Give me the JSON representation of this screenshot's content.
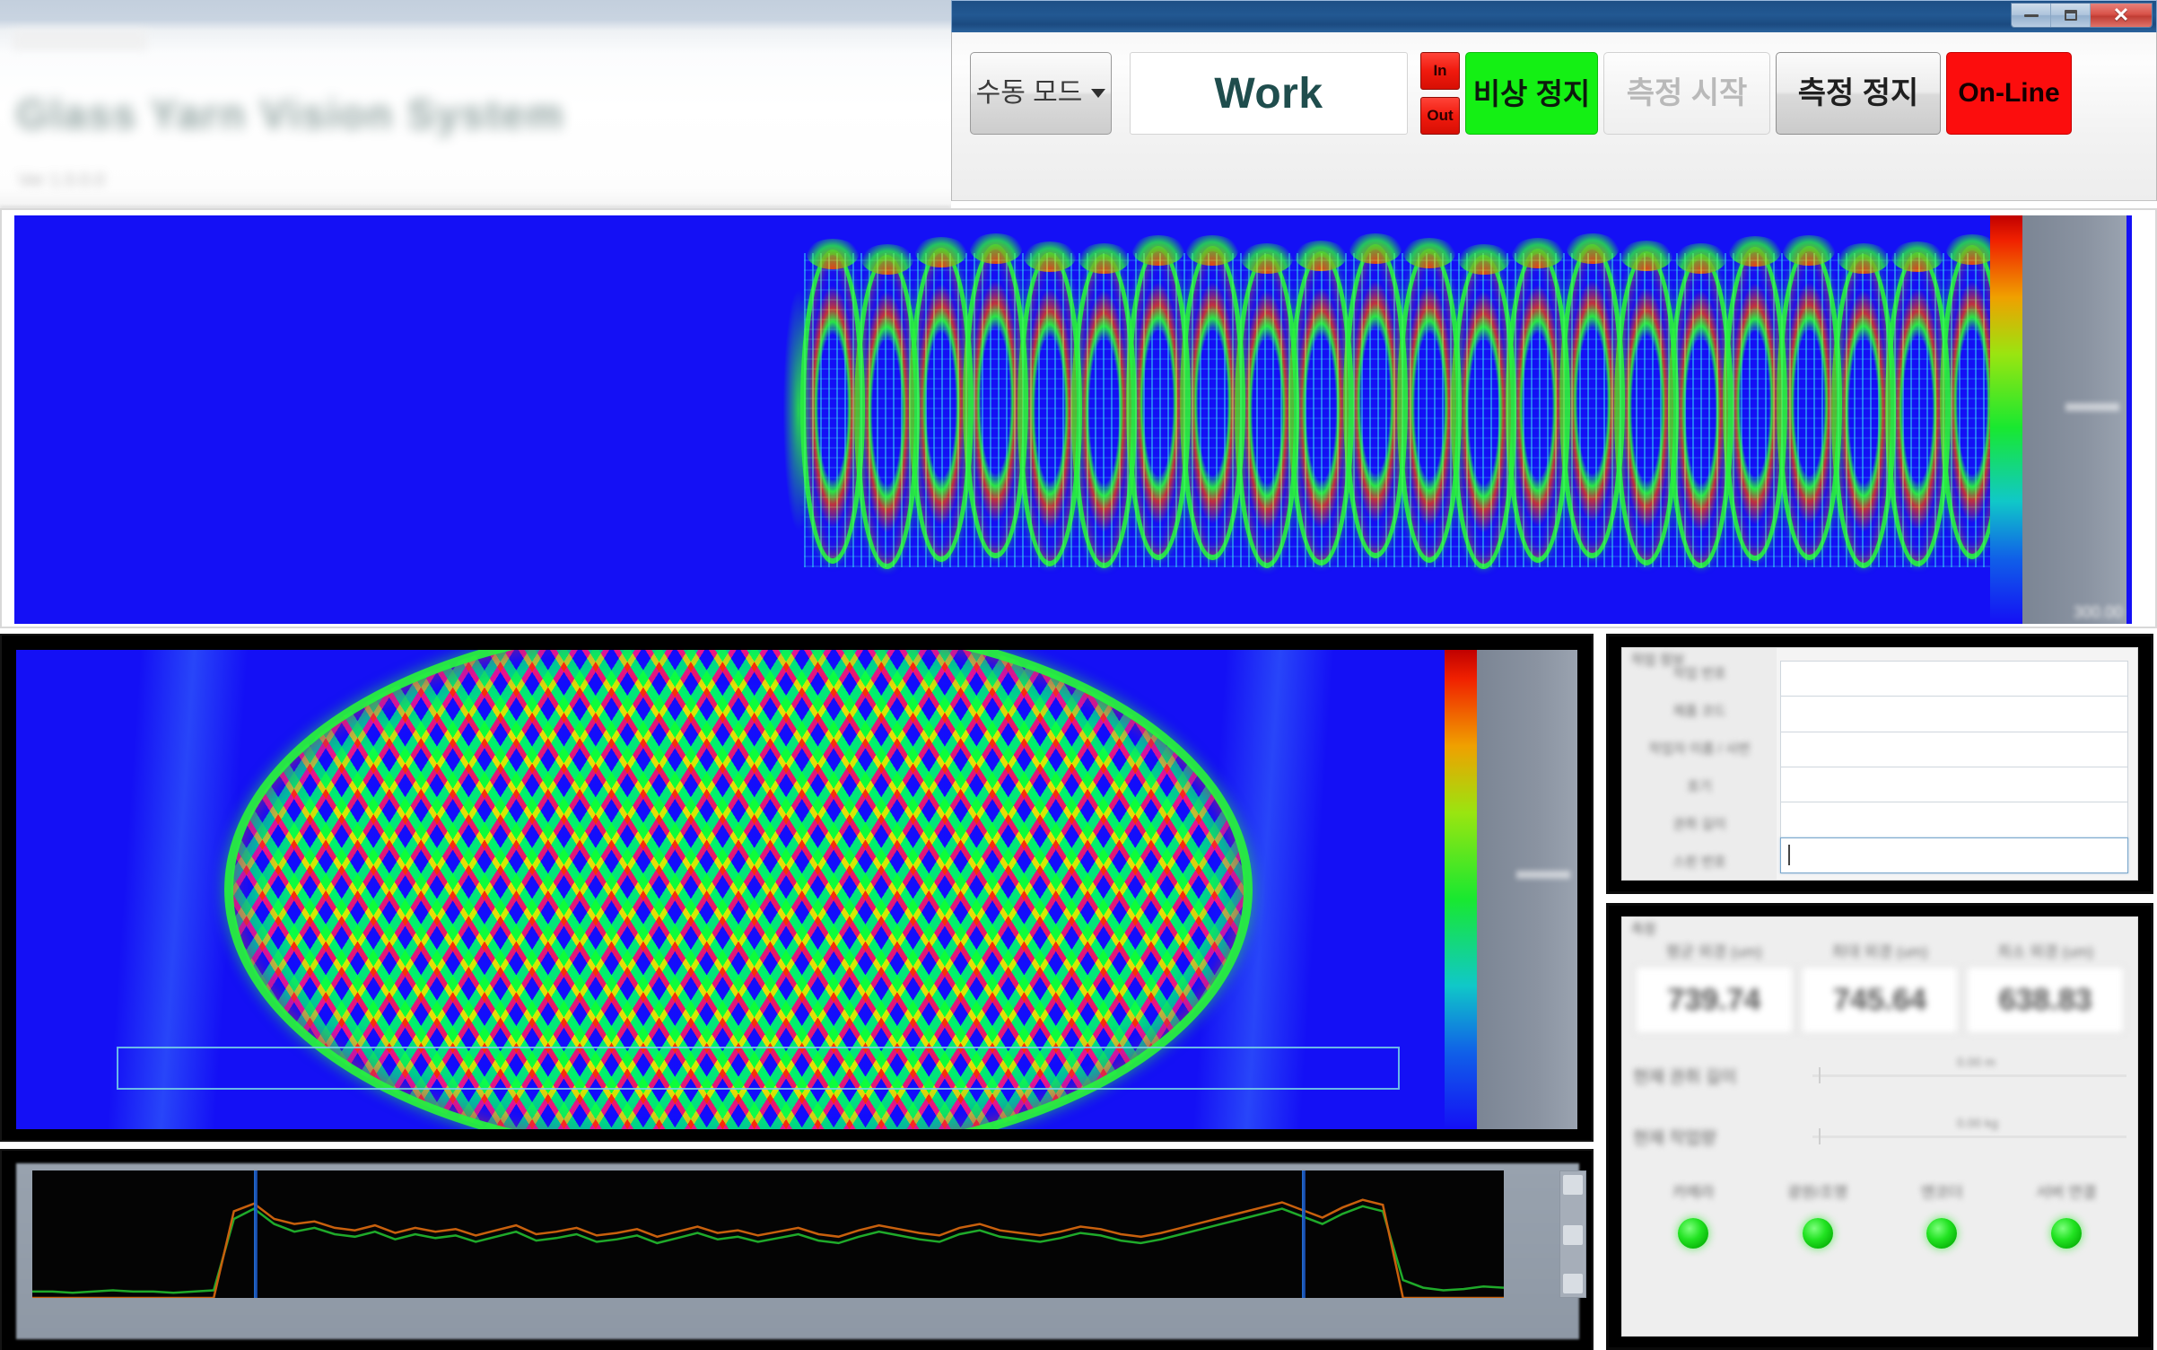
{
  "background_window": {
    "title": "Glass Yarn Vision System",
    "subtitle": "Ver 1.0.0.0",
    "menu_label": "File Edit"
  },
  "window": {
    "title": "",
    "controls": {
      "minimize": "–",
      "restore": "❐",
      "close": "✕"
    }
  },
  "toolbar": {
    "mode_button": "수동 모드",
    "mode_caret": "chevron-down-icon",
    "work_display": "Work",
    "in_led": "In",
    "out_led": "Out",
    "emergency_stop": "비상 정지",
    "start_measure": "측정 시작",
    "stop_measure": "측정 정지",
    "online_status": "On-Line",
    "colors": {
      "emergency_bg": "#14f014",
      "online_bg": "#fc0d0d",
      "led_red": "#f01a0e",
      "work_text": "#1f4d4d",
      "titlebar": "#225892"
    }
  },
  "top_view": {
    "name": "wide-thermal-view",
    "colorbar_max_label": "300.00",
    "background_color": "#1410f5"
  },
  "main_view": {
    "name": "main-thermal-view",
    "roi_label": "",
    "background_color": "#1410f5"
  },
  "trend_chart": {
    "name": "trend-chart",
    "background_color": "#040404"
  },
  "form_panel": {
    "legend": "작업 정보",
    "labels": [
      "작업 번호",
      "제품 코드",
      "작업자 이름 / 사번",
      "호기",
      "권취 길이",
      "스핀 번호"
    ],
    "values": [
      "",
      "",
      "",
      "",
      "",
      ""
    ],
    "focused_index": 5
  },
  "status_panel": {
    "legend": "측정",
    "result_headers": [
      "평균 외경 (um)",
      "최대 외경 (um)",
      "최소 외경 (um)"
    ],
    "result_values": [
      "739.74",
      "745.64",
      "638.83"
    ],
    "meters": [
      {
        "label": "현재 권취 길이",
        "value_label": "0.00 m"
      },
      {
        "label": "현재 작업량",
        "value_label": "0.00 kg"
      }
    ],
    "indicators": [
      {
        "label": "카메라",
        "state": "ok",
        "color": "#22e322"
      },
      {
        "label": "광원/조명",
        "state": "ok",
        "color": "#22e322"
      },
      {
        "label": "엔코더",
        "state": "ok",
        "color": "#22e322"
      },
      {
        "label": "서버 연결",
        "state": "ok",
        "color": "#22e322"
      }
    ]
  },
  "chart_data": {
    "type": "line",
    "title": "",
    "xlabel": "",
    "ylabel": "",
    "series": [
      {
        "name": "diameter-green",
        "color": "#1faa2a",
        "values": [
          5,
          5,
          4,
          5,
          6,
          5,
          5,
          4,
          5,
          6,
          62,
          70,
          58,
          52,
          55,
          50,
          48,
          52,
          46,
          50,
          47,
          49,
          44,
          48,
          52,
          45,
          47,
          50,
          44,
          46,
          49,
          43,
          47,
          51,
          46,
          48,
          44,
          47,
          50,
          45,
          43,
          48,
          52,
          49,
          46,
          44,
          50,
          53,
          48,
          46,
          44,
          47,
          51,
          49,
          45,
          43,
          46,
          50,
          54,
          58,
          62,
          66,
          70,
          64,
          58,
          66,
          72,
          68,
          14,
          8,
          6,
          7,
          9,
          8
        ]
      },
      {
        "name": "diameter-orange",
        "color": "#c8600d",
        "values": [
          0,
          0,
          0,
          0,
          0,
          0,
          0,
          0,
          0,
          0,
          68,
          74,
          62,
          58,
          60,
          55,
          53,
          57,
          51,
          55,
          52,
          54,
          49,
          53,
          57,
          50,
          52,
          55,
          49,
          51,
          54,
          48,
          52,
          56,
          51,
          53,
          49,
          52,
          55,
          50,
          48,
          53,
          57,
          54,
          51,
          49,
          55,
          58,
          53,
          51,
          49,
          52,
          56,
          54,
          50,
          48,
          51,
          55,
          59,
          63,
          67,
          71,
          75,
          69,
          63,
          71,
          77,
          73,
          0,
          0,
          0,
          0,
          0,
          0
        ]
      }
    ],
    "cursors": [
      11,
      63
    ],
    "ylim": [
      0,
      100
    ],
    "grid": false,
    "legend_position": "none"
  }
}
